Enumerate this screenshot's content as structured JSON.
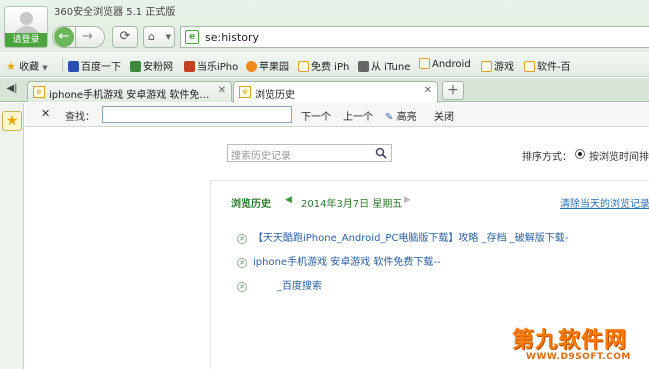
{
  "window": {
    "title": "360安全浏览器 5.1 正式版"
  },
  "user": {
    "login_label": "请登录"
  },
  "nav": {
    "back": "←",
    "forward": "→",
    "refresh": "⟳",
    "home": "⌂",
    "address": "se:history"
  },
  "favbar": {
    "items": [
      {
        "label": "收藏",
        "icon": "star-icon"
      },
      {
        "label": "百度一下",
        "icon": "paw-icon"
      },
      {
        "label": "安粉网",
        "icon": "site-icon"
      },
      {
        "label": "当乐iPho",
        "icon": "site-icon"
      },
      {
        "label": "苹果园",
        "icon": "apple-icon"
      },
      {
        "label": "免费 iPh",
        "icon": "page-icon"
      },
      {
        "label": "从 iTune",
        "icon": "page-icon"
      },
      {
        "label": "Android",
        "icon": "page-icon"
      },
      {
        "label": "游戏",
        "icon": "page-icon"
      },
      {
        "label": "软件-百",
        "icon": "page-icon"
      }
    ]
  },
  "tabs": [
    {
      "label": "iphone手机游戏 安卓游戏 软件免…",
      "active": false
    },
    {
      "label": "浏览历史",
      "active": true
    }
  ],
  "find": {
    "label": "查找：",
    "next": "下一个",
    "prev": "上一个",
    "highlight": "高亮",
    "close": "关闭"
  },
  "history": {
    "search_placeholder": "搜索历史记录",
    "sort_label": "排序方式：",
    "sort_option": "按浏览时间排",
    "title": "浏览历史",
    "date": "2014年3月7日 星期五",
    "clear_link": "清除当天的浏览记录",
    "entries": [
      "【天天酷跑iPhone_Android_PC电脑版下载】攻略 _存档 _破解版下载-",
      "iphone手机游戏 安卓游戏 软件免费下载--",
      "_百度搜索"
    ]
  },
  "watermark": {
    "big": "第九软件网",
    "small": "WWW.D9SOFT.COM"
  },
  "colors": {
    "accent": "#4aa53f",
    "link": "#2a6fb5",
    "watermark": "#ff7a00"
  }
}
